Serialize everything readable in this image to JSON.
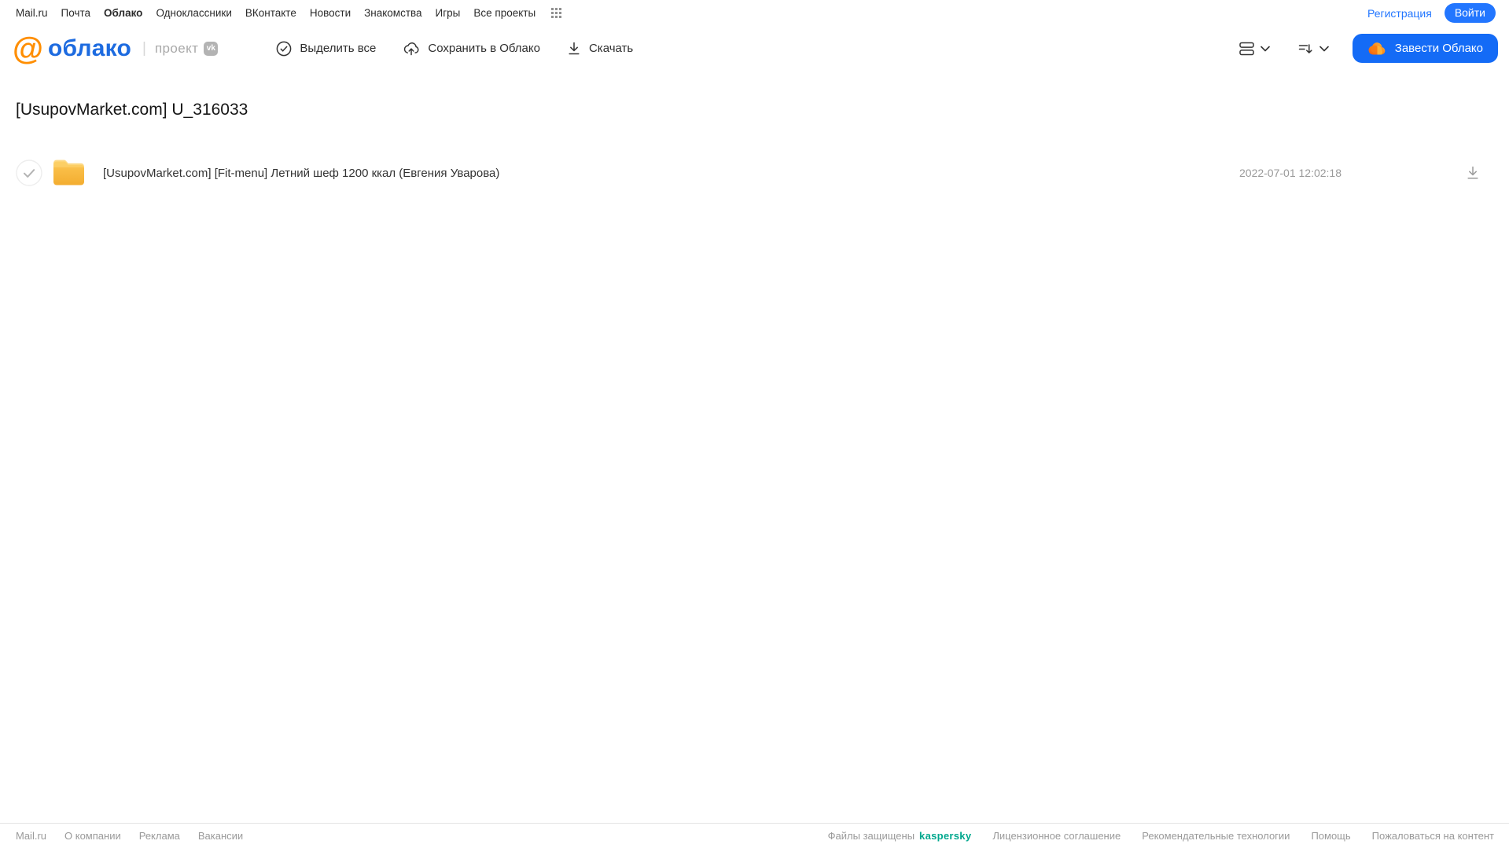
{
  "topnav": {
    "items": [
      "Mail.ru",
      "Почта",
      "Облако",
      "Одноклассники",
      "ВКонтакте",
      "Новости",
      "Знакомства",
      "Игры",
      "Все проекты"
    ],
    "active_item": "Облако",
    "registration_label": "Регистрация",
    "login_label": "Войти"
  },
  "header": {
    "logo_at": "@",
    "logo_text": "облако",
    "divider": "|",
    "project_label": "проект",
    "vk_badge": "vk",
    "toolbar": {
      "select_all": "Выделить все",
      "save_to_cloud": "Сохранить в Облако",
      "download": "Скачать"
    },
    "get_cloud_label": "Завести Облако"
  },
  "main": {
    "title": "[UsupovMarket.com] U_316033",
    "files": [
      {
        "type": "folder",
        "name": "[UsupovMarket.com] [Fit-menu] Летний шеф 1200 ккал (Евгения Уварова)",
        "date": "2022-07-01 12:02:18"
      }
    ]
  },
  "footer": {
    "left_links": [
      "Mail.ru",
      "О компании",
      "Реклама",
      "Вакансии"
    ],
    "protected_label": "Файлы защищены",
    "kaspersky_label": "kaspersky",
    "right_links": [
      "Лицензионное соглашение",
      "Рекомендательные технологии",
      "Помощь",
      "Пожаловаться на контент"
    ]
  },
  "icons": {
    "grid_dots": "apps-grid",
    "check_circle": "select-all",
    "upload_cloud": "save-to-cloud",
    "download_arrow": "download",
    "list_view": "view-mode",
    "chevron_down": "expand",
    "sort": "sort-order",
    "cloud": "cloud-brand",
    "folder": "folder",
    "row_check": "row-checkbox"
  },
  "colors": {
    "accent_blue": "#2276ff",
    "button_blue": "#146bf6",
    "logo_blue": "#1d6be0",
    "logo_orange": "#ff8e00",
    "folder_yellow": "#f6b93d",
    "kaspersky_teal": "#00a88e",
    "muted_gray": "#9a9a9a"
  }
}
